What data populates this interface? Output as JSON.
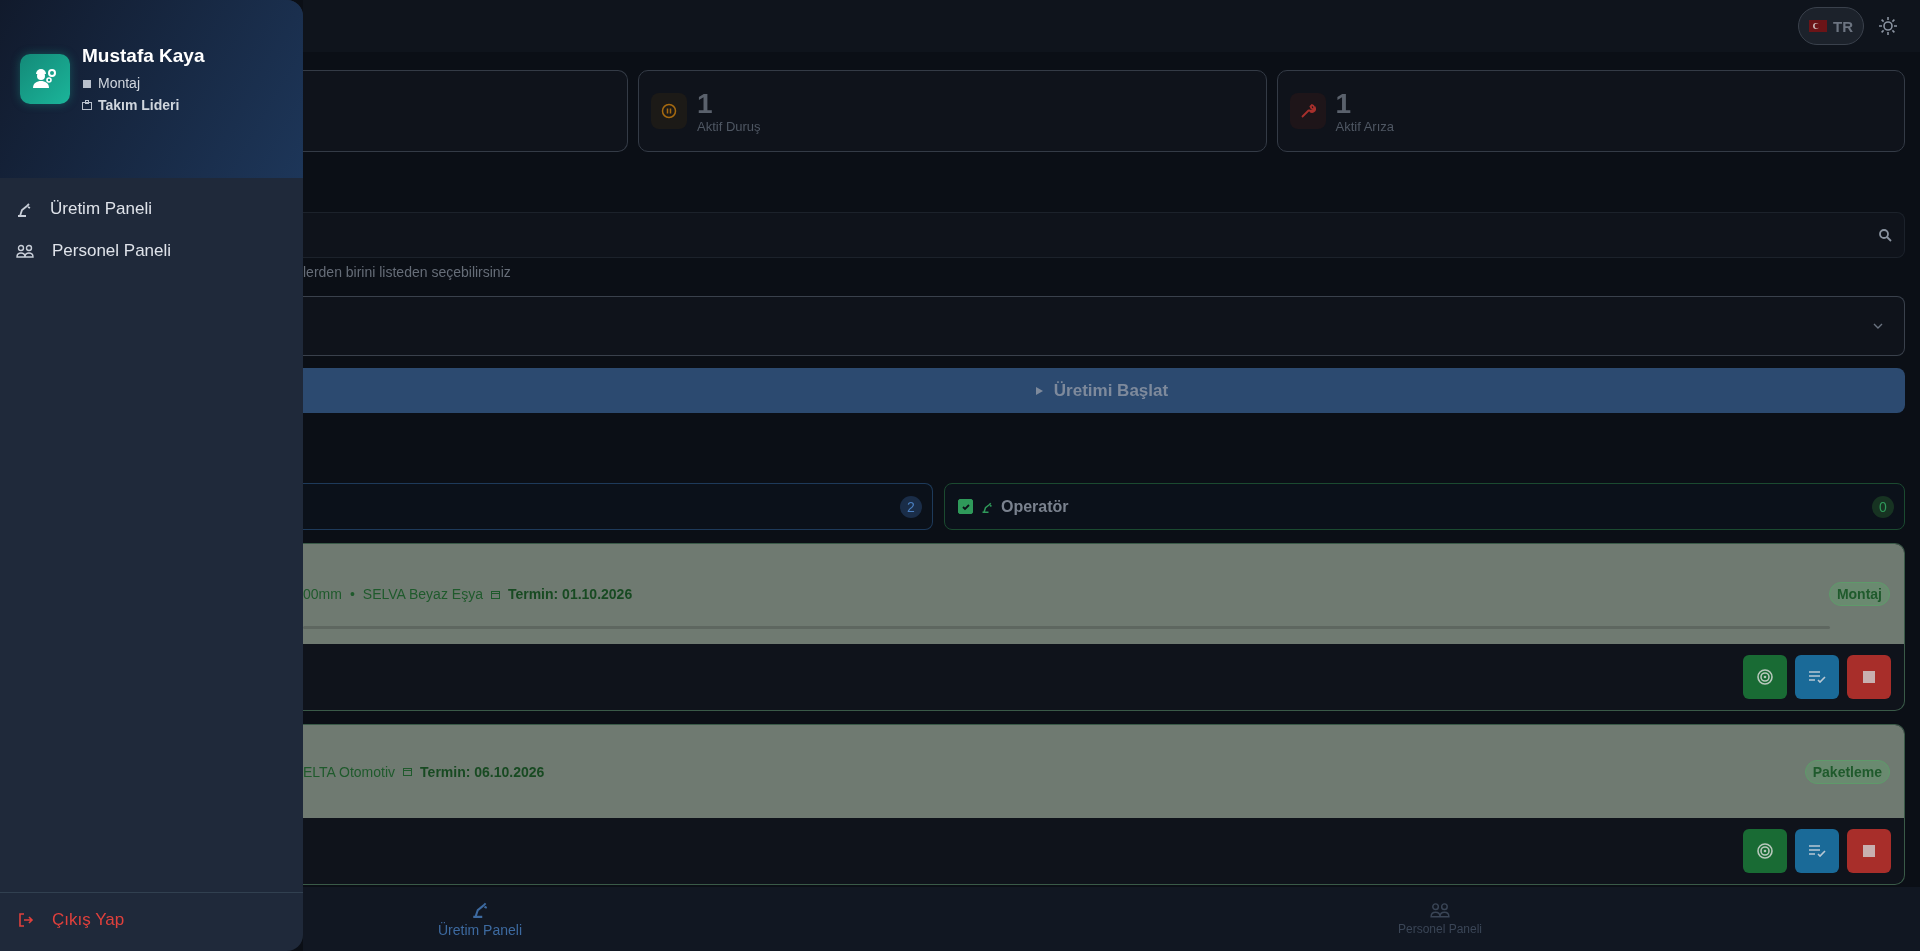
{
  "drawer": {
    "user": {
      "name": "Mustafa Kaya",
      "department": "Montaj",
      "role": "Takım Lideri"
    },
    "menu": [
      {
        "label": "Üretim Paneli",
        "kind": "production"
      },
      {
        "label": "Personel Paneli",
        "kind": "staff"
      }
    ],
    "logout": "Çıkış Yap"
  },
  "top_bar": {
    "language": "TR"
  },
  "stats": [
    {
      "kind": "none"
    },
    {
      "value": "1",
      "label": "Aktif Duruş",
      "kind": "stop"
    },
    {
      "value": "1",
      "label": "Aktif Arıza",
      "kind": "fault"
    }
  ],
  "search": {
    "hint": "lerden birini listeden seçebilirsiniz"
  },
  "start_button": "Üretimi Başlat",
  "filter_left": {
    "count": "2"
  },
  "operator_filter": {
    "label": "Operatör",
    "checked": true,
    "count": "0"
  },
  "orders": [
    {
      "parts": [
        "00mm",
        "•",
        "SELVA Beyaz Eşya"
      ],
      "due": "Termin: 01.10.2026",
      "station": "Montaj",
      "progress": true
    },
    {
      "parts": [
        "ELTA Otomotiv"
      ],
      "due": "Termin: 06.10.2026",
      "station": "Paketleme",
      "progress": false
    }
  ],
  "bottom_nav": [
    {
      "label": "Üretim Paneli",
      "kind": "production",
      "selected": true
    },
    {
      "label": "Personel Paneli",
      "kind": "staff",
      "selected": false
    }
  ]
}
